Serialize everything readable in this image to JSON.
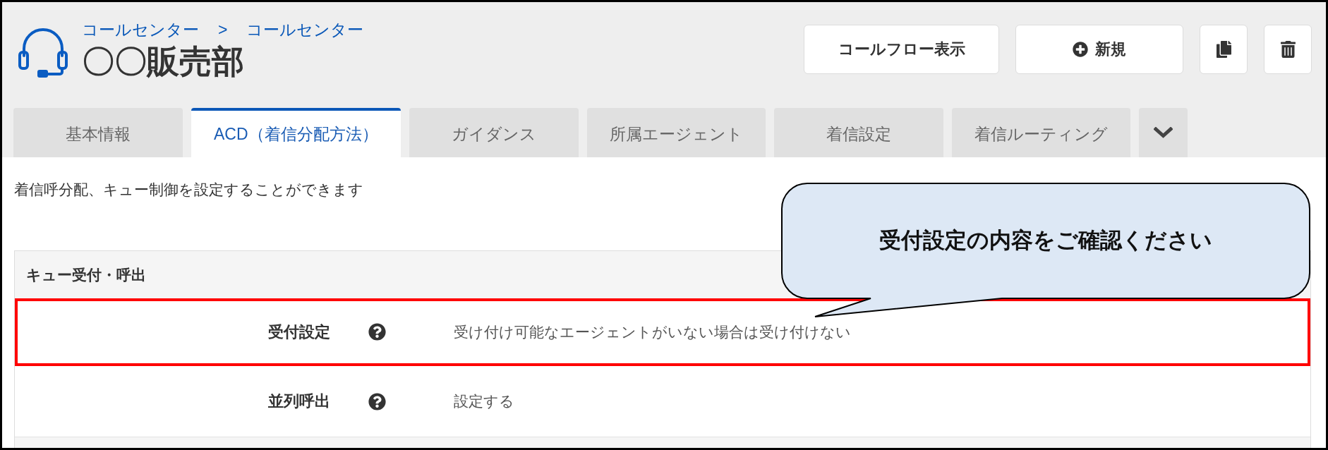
{
  "header": {
    "breadcrumb": [
      "コールセンター",
      "コールセンター"
    ],
    "breadcrumb_separator": ">",
    "title": "〇〇販売部"
  },
  "actions": {
    "call_flow_button": "コールフロー表示",
    "new_button": "新規"
  },
  "tabs": [
    {
      "label": "基本情報",
      "selected": false
    },
    {
      "label": "ACD（着信分配方法）",
      "selected": true
    },
    {
      "label": "ガイダンス",
      "selected": false
    },
    {
      "label": "所属エージェント",
      "selected": false
    },
    {
      "label": "着信設定",
      "selected": false
    },
    {
      "label": "着信ルーティング",
      "selected": false
    }
  ],
  "description": "着信呼分配、キュー制御を設定することができます",
  "section": {
    "title": "キュー受付・呼出",
    "rows": [
      {
        "label": "受付設定",
        "value": "受け付け可能なエージェントがいない場合は受け付けない",
        "highlighted": true
      },
      {
        "label": "並列呼出",
        "value": "設定する",
        "highlighted": false
      }
    ]
  },
  "callout": {
    "text": "受付設定の内容をご確認ください"
  }
}
